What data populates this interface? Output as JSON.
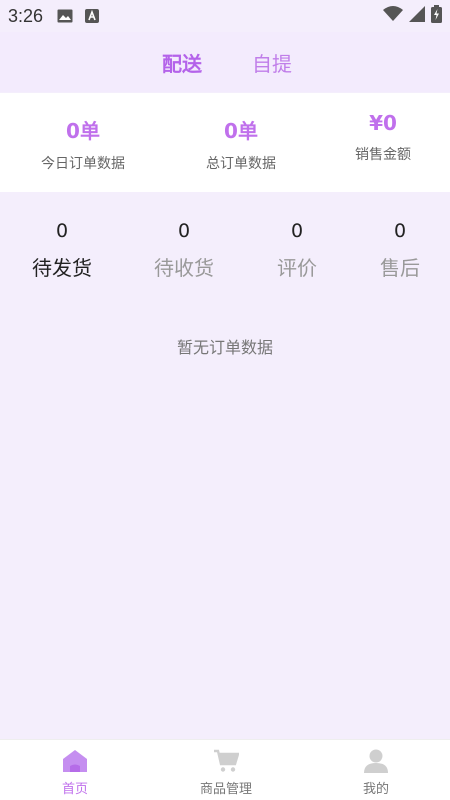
{
  "status_bar": {
    "time": "3:26",
    "icons": [
      "image-icon",
      "font-app-icon",
      "wifi-icon",
      "signal-icon",
      "battery-icon"
    ]
  },
  "top_tabs": [
    {
      "label": "配送",
      "active": true
    },
    {
      "label": "自提",
      "active": false
    }
  ],
  "stats": [
    {
      "value": "0单",
      "label": "今日订单数据"
    },
    {
      "value": "0单",
      "label": "总订单数据"
    },
    {
      "value": "¥0",
      "label": "销售金额"
    }
  ],
  "order_status": [
    {
      "count": "0",
      "label": "待发货",
      "active": true
    },
    {
      "count": "0",
      "label": "待收货",
      "active": false
    },
    {
      "count": "0",
      "label": "评价",
      "active": false
    },
    {
      "count": "0",
      "label": "售后",
      "active": false
    }
  ],
  "empty_text": "暂无订单数据",
  "bottom_nav": [
    {
      "label": "首页",
      "icon": "home-icon",
      "active": true
    },
    {
      "label": "商品管理",
      "icon": "cart-icon",
      "active": false
    },
    {
      "label": "我的",
      "icon": "user-icon",
      "active": false
    }
  ],
  "colors": {
    "accent": "#c070ec",
    "background": "#f4eefc"
  }
}
